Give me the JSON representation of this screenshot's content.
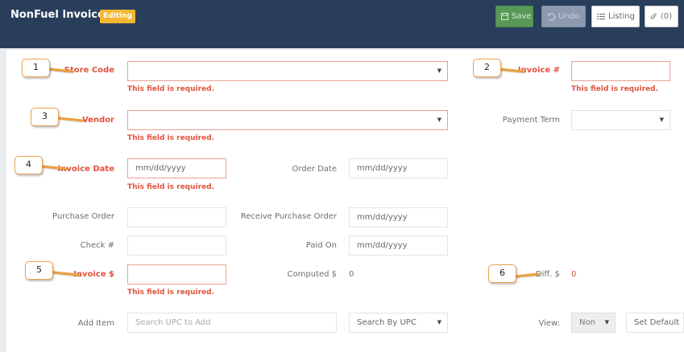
{
  "header": {
    "title": "NonFuel Invoice",
    "badge": "Editing",
    "buttons": {
      "save": "Save",
      "undo": "Undo",
      "listing": "Listing",
      "attachments": "(0)"
    }
  },
  "form": {
    "store_code": {
      "label": "Store Code",
      "value": "",
      "error": "This field is required."
    },
    "invoice_no": {
      "label": "Invoice #",
      "value": "",
      "error": "This field is required."
    },
    "vendor": {
      "label": "Vendor",
      "value": "",
      "error": "This field is required."
    },
    "payment_term": {
      "label": "Payment Term",
      "value": ""
    },
    "invoice_date": {
      "label": "Invoice Date",
      "placeholder": "mm/dd/yyyy",
      "error": "This field is required."
    },
    "order_date": {
      "label": "Order Date",
      "placeholder": "mm/dd/yyyy"
    },
    "purchase_order": {
      "label": "Purchase Order",
      "value": ""
    },
    "receive_po": {
      "label": "Receive Purchase Order",
      "placeholder": "mm/dd/yyyy"
    },
    "check_no": {
      "label": "Check #",
      "value": ""
    },
    "paid_on": {
      "label": "Paid On",
      "placeholder": "mm/dd/yyyy"
    },
    "invoice_amount": {
      "label": "Invoice $",
      "value": "",
      "error": "This field is required."
    },
    "computed": {
      "label": "Computed $",
      "value": "0"
    },
    "diff": {
      "label": "Diff. $",
      "value": "0"
    },
    "add_item": {
      "label": "Add Item",
      "placeholder": "Search UPC to Add"
    },
    "search_by": {
      "value": "Search By UPC"
    },
    "view": {
      "label": "View:",
      "value": "Non"
    },
    "set_default": {
      "label": "Set Default"
    }
  },
  "callouts": [
    "1",
    "2",
    "3",
    "4",
    "5",
    "6"
  ],
  "colors": {
    "header_bg": "#283e5b",
    "badge": "#f5b731",
    "error": "#e0533b",
    "save": "#5a9857",
    "callout_border": "#e8a24c"
  }
}
